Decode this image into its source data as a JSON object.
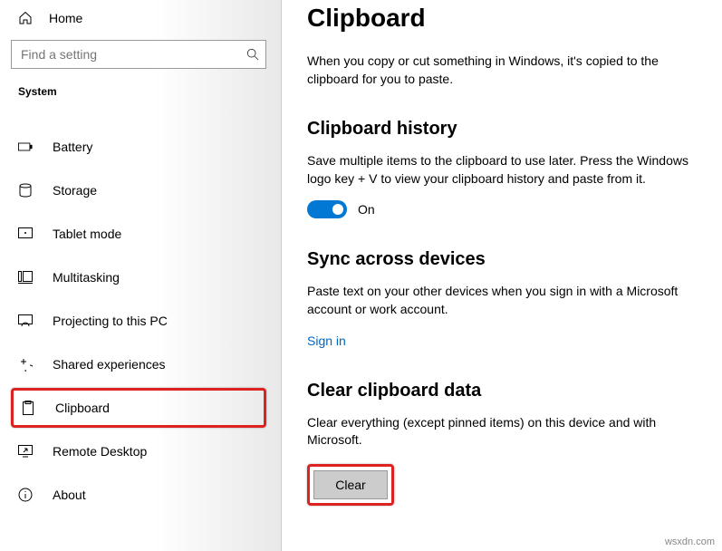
{
  "home": {
    "label": "Home"
  },
  "search": {
    "placeholder": "Find a setting"
  },
  "section_title": "System",
  "nav": [
    {
      "id": "battery",
      "label": "Battery"
    },
    {
      "id": "storage",
      "label": "Storage"
    },
    {
      "id": "tablet-mode",
      "label": "Tablet mode"
    },
    {
      "id": "multitasking",
      "label": "Multitasking"
    },
    {
      "id": "projecting",
      "label": "Projecting to this PC"
    },
    {
      "id": "shared-experiences",
      "label": "Shared experiences"
    },
    {
      "id": "clipboard",
      "label": "Clipboard"
    },
    {
      "id": "remote-desktop",
      "label": "Remote Desktop"
    },
    {
      "id": "about",
      "label": "About"
    }
  ],
  "page": {
    "title": "Clipboard",
    "intro": "When you copy or cut something in Windows, it's copied to the clipboard for you to paste.",
    "history": {
      "heading": "Clipboard history",
      "desc": "Save multiple items to the clipboard to use later. Press the Windows logo key + V to view your clipboard history and paste from it.",
      "toggle_state": "On"
    },
    "sync": {
      "heading": "Sync across devices",
      "desc": "Paste text on your other devices when you sign in with a Microsoft account or work account.",
      "signin": "Sign in"
    },
    "clear": {
      "heading": "Clear clipboard data",
      "desc": "Clear everything (except pinned items) on this device and with Microsoft.",
      "button": "Clear"
    }
  },
  "watermark": "wsxdn.com"
}
